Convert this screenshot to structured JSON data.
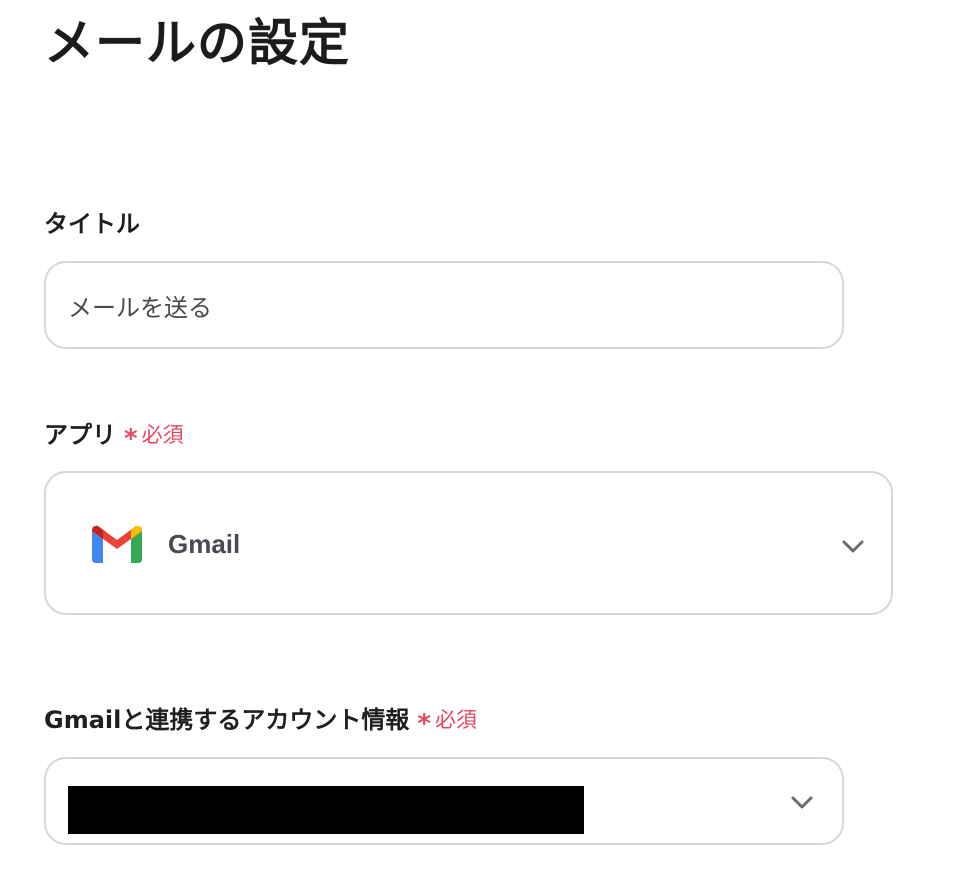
{
  "page": {
    "title": "メールの設定"
  },
  "form": {
    "title_field": {
      "label": "タイトル",
      "value": "メールを送る"
    },
    "app_field": {
      "label": "アプリ",
      "required_mark": "*",
      "required_text": "必須",
      "selected_app": "Gmail",
      "app_icon": "gmail-logo-icon"
    },
    "account_field": {
      "label": "Gmailと連携するアカウント情報",
      "required_mark": "*",
      "required_text": "必須",
      "selected_value_redacted": true
    }
  },
  "colors": {
    "required": "#e8475f",
    "border": "#d6d6d6",
    "chevron": "#6b6b6b"
  }
}
